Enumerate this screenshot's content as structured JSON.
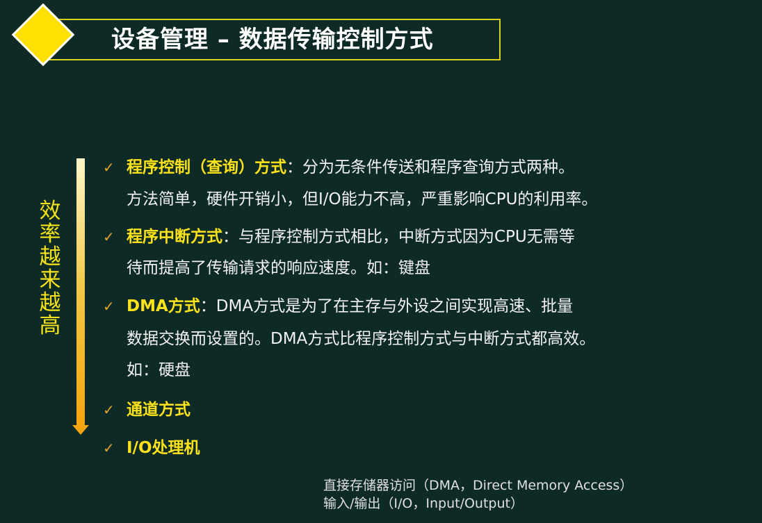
{
  "title": "设备管理 – 数据传输控制方式",
  "side_label": "效率越来越高",
  "items": [
    {
      "term": "程序控制（查询）方式",
      "sep": "：",
      "lines": [
        "分为无条件传送和程序查询方式两种。",
        "方法简单，硬件开销小，但I/O能力不高，严重影响CPU的利用率。"
      ]
    },
    {
      "term": "程序中断方式",
      "sep": "：",
      "lines": [
        "与程序控制方式相比，中断方式因为CPU无需等",
        "待而提高了传输请求的响应速度。如：键盘"
      ]
    },
    {
      "term": "DMA方式",
      "sep": "：",
      "lines": [
        "DMA方式是为了在主存与外设之间实现高速、批量",
        "数据交换而设置的。DMA方式比程序控制方式与中断方式都高效。",
        "如：硬盘"
      ]
    },
    {
      "term": "通道方式"
    },
    {
      "term": "I/O处理机"
    }
  ],
  "footnotes": [
    "直接存储器访问（DMA，Direct Memory Access）",
    "输入/输出（I/O，Input/Output）"
  ],
  "colors": {
    "background": "#0e2a26",
    "accent": "#fbe21b",
    "check": "#e7a52a"
  }
}
